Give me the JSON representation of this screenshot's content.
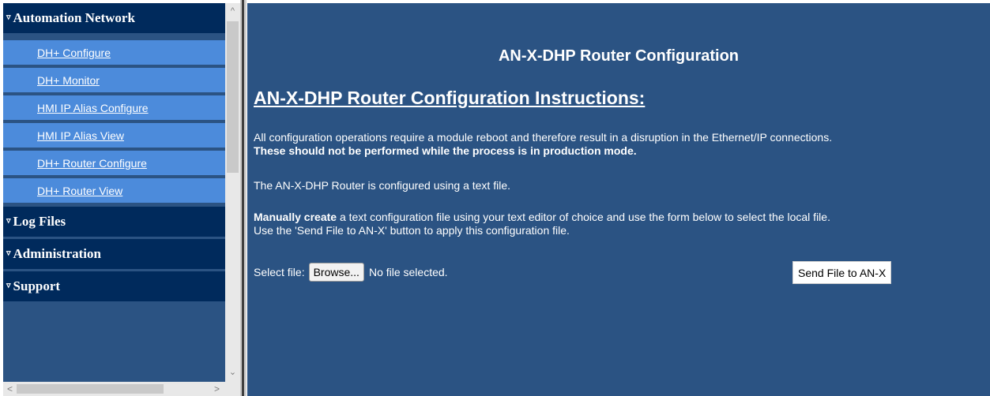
{
  "sidebar": {
    "sections": [
      {
        "label": "Automation Network",
        "expanded": true,
        "items": [
          "DH+ Configure",
          "DH+ Monitor",
          "HMI IP Alias Configure",
          "HMI IP Alias View",
          "DH+ Router Configure",
          "DH+ Router View"
        ]
      },
      {
        "label": "Log Files"
      },
      {
        "label": "Administration"
      },
      {
        "label": "Support"
      }
    ],
    "expand_glyph": "▿",
    "scroll_up_glyph": "^",
    "scroll_down_glyph": "⌄",
    "scroll_left_glyph": "<",
    "scroll_right_glyph": ">"
  },
  "main": {
    "title": "AN-X-DHP Router Configuration",
    "instructions_heading": "AN-X-DHP Router Configuration Instructions:",
    "para1": "All configuration operations require a module reboot and therefore result in a disruption in the Ethernet/IP connections.",
    "para1_bold": "These should not be performed while the process is in production mode.",
    "para2": "The AN-X-DHP Router is configured using a text file.",
    "para3_bold": "Manually create",
    "para3_rest": " a text configuration file using your text editor of choice and use the form below to select the local file.",
    "para3_line2": "Use the 'Send File to AN-X' button to apply this configuration file.",
    "select_label": "Select file:",
    "browse_label": "Browse...",
    "no_file_text": "No file selected.",
    "send_label": "Send File to AN-X"
  },
  "colors": {
    "background": "#2b5383",
    "section_header": "#002a5c",
    "sub_item": "#4c8bdb"
  }
}
